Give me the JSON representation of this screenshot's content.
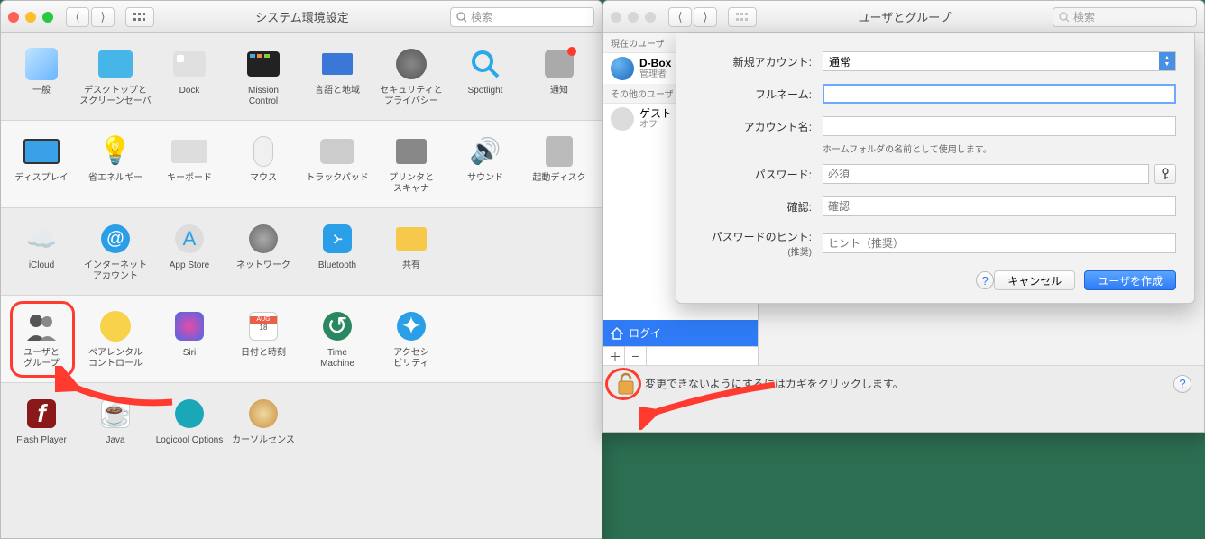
{
  "win1": {
    "title": "システム環境設定",
    "search_placeholder": "検索",
    "rows": [
      [
        "一般",
        "デスクトップと\nスクリーンセーバ",
        "Dock",
        "Mission\nControl",
        "言語と地域",
        "セキュリティと\nプライバシー",
        "Spotlight",
        "通知"
      ],
      [
        "ディスプレイ",
        "省エネルギー",
        "キーボード",
        "マウス",
        "トラックパッド",
        "プリンタと\nスキャナ",
        "サウンド",
        "起動ディスク"
      ],
      [
        "iCloud",
        "インターネット\nアカウント",
        "App Store",
        "ネットワーク",
        "Bluetooth",
        "共有"
      ],
      [
        "ユーザと\nグループ",
        "ペアレンタル\nコントロール",
        "Siri",
        "日付と時刻",
        "Time\nMachine",
        "アクセシ\nビリティ"
      ],
      [
        "Flash Player",
        "Java",
        "Logicool Options",
        "カーソルセンス"
      ]
    ],
    "highlight_label": "ユーザと\nグループ"
  },
  "win2": {
    "title": "ユーザとグループ",
    "search_placeholder": "検索",
    "sidebar": {
      "current_hdr": "現在のユーザ",
      "current_user": "D-Box",
      "current_role": "管理者",
      "other_hdr": "その他のユーザ",
      "guest": "ゲスト",
      "guest_sub": "オフ",
      "login_options": "ログイ",
      "add": "＋",
      "remove": "−"
    },
    "sheet": {
      "new_account": "新規アカウント:",
      "account_type": "通常",
      "fullname": "フルネーム:",
      "accountname": "アカウント名:",
      "accountname_hint": "ホームフォルダの名前として使用します。",
      "password": "パスワード:",
      "password_ph": "必須",
      "confirm": "確認:",
      "confirm_ph": "確認",
      "hint": "パスワードのヒント:",
      "hint_sub": "(推奨)",
      "hint_ph": "ヒント（推奨）",
      "cancel": "キャンセル",
      "create": "ユーザを作成"
    },
    "lock_msg": "変更できないようにするにはカギをクリックします。"
  }
}
